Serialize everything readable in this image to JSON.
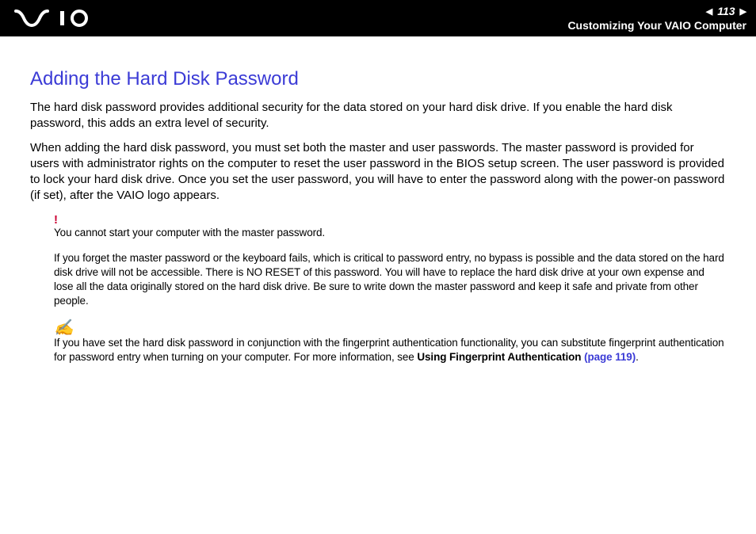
{
  "header": {
    "page_number": "113",
    "breadcrumb": "Customizing Your VAIO Computer"
  },
  "title": "Adding the Hard Disk Password",
  "paragraphs": {
    "p1": "The hard disk password provides additional security for the data stored on your hard disk drive. If you enable the hard disk password, this adds an extra level of security.",
    "p2": "When adding the hard disk password, you must set both the master and user passwords. The master password is provided for users with administrator rights on the computer to reset the user password in the BIOS setup screen. The user password is provided to lock your hard disk drive. Once you set the user password, you will have to enter the password along with the power-on password (if set), after the VAIO logo appears."
  },
  "warning": {
    "icon": "!",
    "line1": "You cannot start your computer with the master password.",
    "line2": "If you forget the master password or the keyboard fails, which is critical to password entry, no bypass is possible and the data stored on the hard disk drive will not be accessible. There is NO RESET of this password. You will have to replace the hard disk drive at your own expense and lose all the data originally stored on the hard disk drive. Be sure to write down the master password and keep it safe and private from other people."
  },
  "tip": {
    "icon": "✍",
    "text_prefix": "If you have set the hard disk password in conjunction with the fingerprint authentication functionality, you can substitute fingerprint authentication for password entry when turning on your computer. For more information, see ",
    "bold_text": "Using Fingerprint Authentication ",
    "link_text": "(page 119)",
    "suffix": "."
  }
}
